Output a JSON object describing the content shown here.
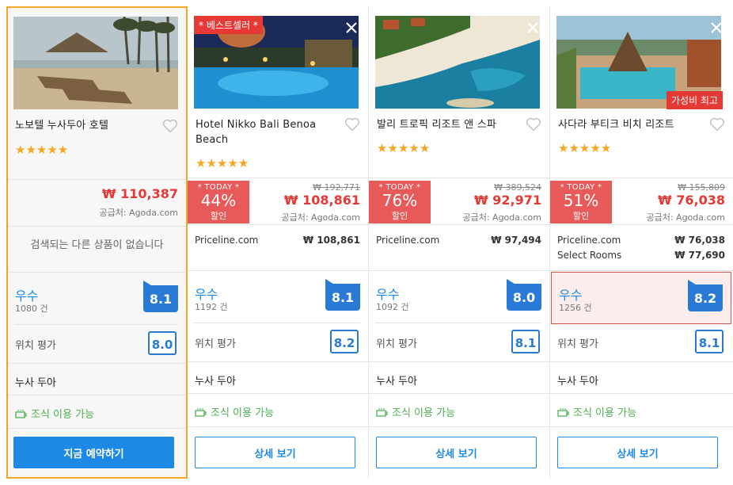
{
  "hotels": [
    {
      "name": "노보텔 누사두아 호텔",
      "stars": "★★★★★",
      "price": "₩ 110,387",
      "supplier": "공급처: Agoda.com",
      "no_results": "검색되는 다른 상품이 없습니다",
      "rating_word": "우수",
      "review_count": "1080 건",
      "score": "8.1",
      "location_label": "위치 평가",
      "location_score": "8.0",
      "area": "누사 두아",
      "breakfast": "조식 이용 가능",
      "button": "지금 예약하기"
    },
    {
      "ribbon": "* 베스트셀러 *",
      "name": "Hotel Nikko Bali Benoa Beach",
      "stars": "★★★★★",
      "today_label": "* TODAY *",
      "discount": "44%",
      "discount_suffix": "할인",
      "old_price": "₩ 192,771",
      "price": "₩ 108,861",
      "supplier": "공급처: Agoda.com",
      "offers": [
        {
          "site": "Priceline.com",
          "price": "₩ 108,861"
        }
      ],
      "rating_word": "우수",
      "review_count": "1192 건",
      "score": "8.1",
      "location_label": "위치 평가",
      "location_score": "8.2",
      "area": "누사 두아",
      "breakfast": "조식 이용 가능",
      "button": "상세 보기"
    },
    {
      "name": "발리 트로픽 리조트 앤 스파",
      "stars": "★★★★★",
      "today_label": "* TODAY *",
      "discount": "76%",
      "discount_suffix": "할인",
      "old_price": "₩ 389,524",
      "price": "₩ 92,971",
      "supplier": "공급처: Agoda.com",
      "offers": [
        {
          "site": "Priceline.com",
          "price": "₩ 97,494"
        }
      ],
      "rating_word": "우수",
      "review_count": "1092 건",
      "score": "8.0",
      "location_label": "위치 평가",
      "location_score": "8.1",
      "area": "누사 두아",
      "breakfast": "조식 이용 가능",
      "button": "상세 보기"
    },
    {
      "value_badge": "가성비 최고",
      "name": "사다라 부티크 비치 리조트",
      "stars": "★★★★★",
      "today_label": "* TODAY *",
      "discount": "51%",
      "discount_suffix": "할인",
      "old_price": "₩ 155,809",
      "price": "₩ 76,038",
      "supplier": "공급처: Agoda.com",
      "offers": [
        {
          "site": "Priceline.com",
          "price": "₩ 76,038"
        },
        {
          "site": "Select Rooms",
          "price": "₩ 77,690"
        }
      ],
      "rating_word": "우수",
      "review_count": "1256 건",
      "score": "8.2",
      "location_label": "위치 평가",
      "location_score": "8.1",
      "area": "누사 두아",
      "breakfast": "조식 이용 가능",
      "button": "상세 보기"
    }
  ],
  "colors": {
    "accent_blue": "#1e88e5",
    "price_red": "#e53935",
    "selected_border": "#f5a623",
    "breakfast_green": "#4caf50"
  }
}
